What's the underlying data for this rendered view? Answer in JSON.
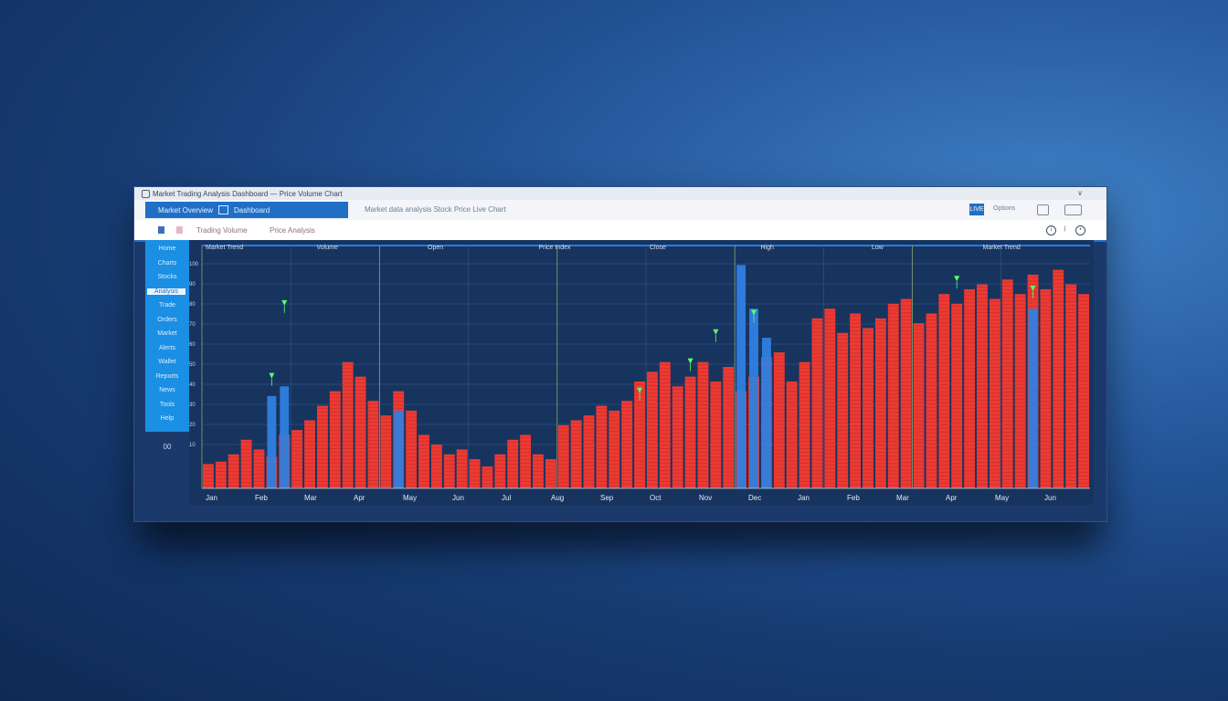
{
  "window": {
    "title": "Market Trading Analysis Dashboard — Price Volume Chart"
  },
  "toolbar": {
    "tab_label": "Market Overview",
    "tab_second": "Dashboard",
    "crumbs": "Market data analysis  Stock Price  Live Chart",
    "blue_button": "LIVE",
    "label": "Options"
  },
  "subbar": {
    "tabs": [
      "Trading Volume",
      "Price Analysis"
    ]
  },
  "sidebar": {
    "items": [
      "Home",
      "Charts",
      "Stocks",
      "Analysis",
      "Trade",
      "Orders",
      "Market",
      "Alerts",
      "Wallet",
      "Reports",
      "News",
      "Tools",
      "Help"
    ],
    "selected_index": 3,
    "footer": "00"
  },
  "colors": {
    "up": "#ff3b30",
    "down": "#2f7fe0",
    "signal": "#5cff6a",
    "accent": "#1f6fc7"
  },
  "chart_data": {
    "type": "bar",
    "xlabel": "",
    "ylabel": "",
    "y_ticks": [
      "100",
      "90",
      "80",
      "70",
      "60",
      "50",
      "40",
      "30",
      "20",
      "10"
    ],
    "x_labels": [
      "Jan",
      "Feb",
      "Mar",
      "Apr",
      "May",
      "Jun",
      "Jul",
      "Aug",
      "Sep",
      "Oct",
      "Nov",
      "Dec",
      "Jan",
      "Feb",
      "Mar",
      "Apr",
      "May",
      "Jun"
    ],
    "header_labels": [
      "Market Trend",
      "Volume",
      "Open",
      "Price Index",
      "Close",
      "High",
      "Low",
      "Market Trend"
    ],
    "ylim": [
      0,
      100
    ],
    "series": [
      {
        "name": "",
        "color": "#ff3b30",
        "values": [
          10,
          11,
          14,
          20,
          16,
          13,
          22,
          24,
          28,
          34,
          40,
          52,
          46,
          36,
          30,
          40,
          32,
          22,
          18,
          14,
          16,
          12,
          9,
          14,
          20,
          22,
          14,
          12,
          26,
          28,
          30,
          34,
          32,
          36,
          44,
          48,
          52,
          42,
          46,
          52,
          44,
          50,
          40,
          46,
          54,
          56,
          44,
          52,
          70,
          74,
          64,
          72,
          66,
          70,
          76,
          78,
          68,
          72,
          80,
          76,
          82,
          84,
          78,
          86,
          80,
          88,
          82,
          90,
          84,
          80
        ]
      },
      {
        "name": "",
        "color": "#2f7fe0",
        "values": [
          0,
          0,
          0,
          0,
          0,
          38,
          42,
          0,
          0,
          0,
          0,
          0,
          0,
          0,
          0,
          32,
          0,
          0,
          0,
          0,
          0,
          0,
          0,
          0,
          0,
          0,
          0,
          0,
          0,
          0,
          0,
          0,
          0,
          0,
          0,
          0,
          0,
          0,
          0,
          0,
          0,
          0,
          92,
          74,
          62,
          0,
          0,
          0,
          0,
          0,
          0,
          0,
          0,
          0,
          0,
          0,
          0,
          0,
          0,
          0,
          0,
          0,
          0,
          0,
          0,
          74,
          0,
          0,
          0,
          0
        ]
      }
    ],
    "signals": [
      {
        "index": 5,
        "value": 46
      },
      {
        "index": 6,
        "value": 76
      },
      {
        "index": 34,
        "value": 40
      },
      {
        "index": 38,
        "value": 52
      },
      {
        "index": 40,
        "value": 64
      },
      {
        "index": 43,
        "value": 72
      },
      {
        "index": 59,
        "value": 86
      },
      {
        "index": 65,
        "value": 82
      }
    ]
  }
}
